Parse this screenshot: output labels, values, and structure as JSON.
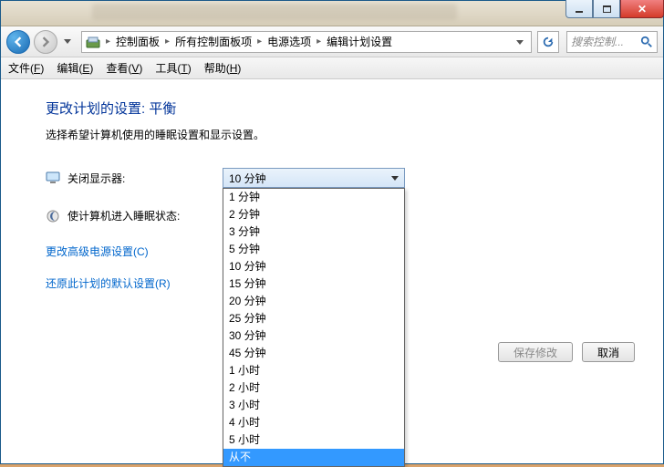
{
  "window_controls": {
    "min": "_",
    "max": "□",
    "close": "✕"
  },
  "breadcrumb": {
    "parts": [
      "控制面板",
      "所有控制面板项",
      "电源选项",
      "编辑计划设置"
    ]
  },
  "search": {
    "placeholder": "搜索控制..."
  },
  "menubar": {
    "file": "文件(F)",
    "edit": "编辑(E)",
    "view": "查看(V)",
    "tools": "工具(T)",
    "help": "帮助(H)"
  },
  "heading": "更改计划的设置: 平衡",
  "subhead": "选择希望计算机使用的睡眠设置和显示设置。",
  "rows": {
    "display_off": {
      "label": "关闭显示器:",
      "value": "10 分钟"
    },
    "sleep": {
      "label": "使计算机进入睡眠状态:"
    }
  },
  "links": {
    "advanced": "更改高级电源设置(C)",
    "restore": "还原此计划的默认设置(R)"
  },
  "buttons": {
    "save": "保存修改",
    "cancel": "取消"
  },
  "dropdown_options": [
    "1 分钟",
    "2 分钟",
    "3 分钟",
    "5 分钟",
    "10 分钟",
    "15 分钟",
    "20 分钟",
    "25 分钟",
    "30 分钟",
    "45 分钟",
    "1 小时",
    "2 小时",
    "3 小时",
    "4 小时",
    "5 小时",
    "从不"
  ],
  "dropdown_selected": "从不"
}
